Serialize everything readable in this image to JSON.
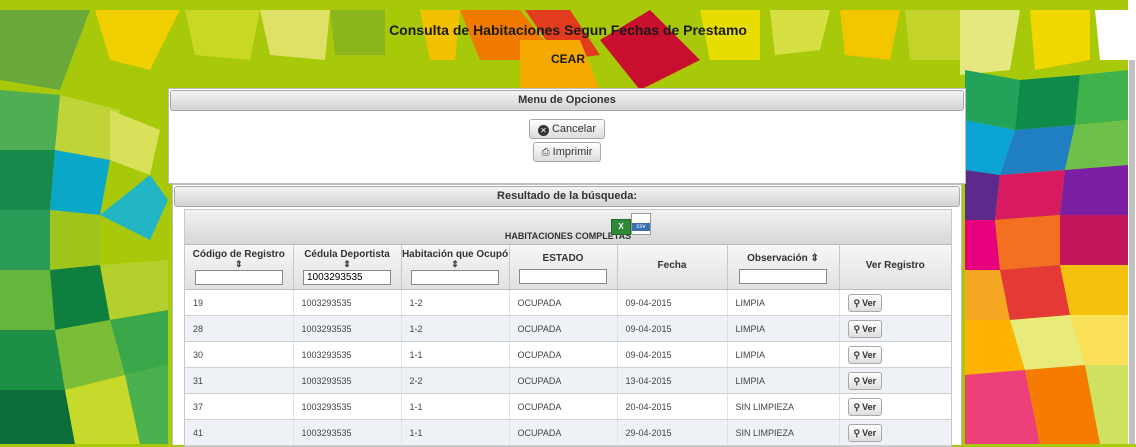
{
  "header": {
    "title": "Consulta de Habitaciones Segun Fechas de Prestamo",
    "subtitle": "CEAR"
  },
  "menu": {
    "title": "Menu de Opciones",
    "cancel_label": "Cancelar",
    "print_label": "Imprimir"
  },
  "results": {
    "title": "Resultado de la búsqueda:",
    "caption": "HABITACIONES COMPLETAS",
    "export_icons": [
      "excel-icon",
      "csv-icon"
    ],
    "export_labels": {
      "excel": "X",
      "csv": "csv"
    },
    "columns": [
      {
        "label": "Código de Registro",
        "sortable": true,
        "filter": ""
      },
      {
        "label": "Cédula Deportista",
        "sortable": true,
        "filter": "1003293535"
      },
      {
        "label": "Habitación que Ocupó",
        "sortable": true,
        "filter": ""
      },
      {
        "label": "ESTADO",
        "sortable": false,
        "filter": ""
      },
      {
        "label": "Fecha",
        "sortable": false
      },
      {
        "label": "Observación",
        "sortable": true,
        "filter": ""
      },
      {
        "label": "Ver Registro",
        "sortable": false
      }
    ],
    "view_label": "Ver",
    "rows": [
      [
        "19",
        "1003293535",
        "1-2",
        "OCUPADA",
        "09-04-2015",
        "LIMPIA"
      ],
      [
        "28",
        "1003293535",
        "1-2",
        "OCUPADA",
        "09-04-2015",
        "LIMPIA"
      ],
      [
        "30",
        "1003293535",
        "1-1",
        "OCUPADA",
        "09-04-2015",
        "LIMPIA"
      ],
      [
        "31",
        "1003293535",
        "2-2",
        "OCUPADA",
        "13-04-2015",
        "LIMPIA"
      ],
      [
        "37",
        "1003293535",
        "1-1",
        "OCUPADA",
        "20-04-2015",
        "SIN LIMPIEZA"
      ],
      [
        "41",
        "1003293535",
        "1-1",
        "OCUPADA",
        "29-04-2015",
        "SIN LIMPIEZA"
      ]
    ]
  },
  "colors": {
    "background": "#a8c80a",
    "row_alt": "#eef2f6"
  }
}
